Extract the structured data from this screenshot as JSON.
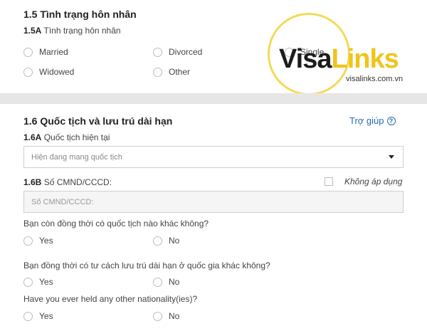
{
  "marital": {
    "title": "1.5 Tình trạng hôn nhân",
    "sub_code": "1.5A",
    "sub_label": "Tình trạng hôn nhân",
    "options": [
      "Married",
      "Divorced",
      "Single",
      "Widowed",
      "Other"
    ]
  },
  "nationality": {
    "title": "1.6 Quốc tịch và lưu trú dài hạn",
    "help_label": "Trợ giúp",
    "help_icon": "?",
    "q_6a_code": "1.6A",
    "q_6a_label": "Quốc tịch hiện tại",
    "select_value": "Hiện đang mang quốc tịch",
    "q_6b_code": "1.6B",
    "q_6b_label": "Số CMND/CCCD:",
    "not_applicable_label": "Không áp dụng",
    "id_placeholder": "Số CMND/CCCD:",
    "q_other_nationality": "Bạn còn đồng thời có quốc tịch nào khác không?",
    "q_other_residency": "Bạn đồng thời có tư cách lưu trú dài hạn ở quốc gia khác không?",
    "q_held_other": "Have you ever held any other nationality(ies)?",
    "yes": "Yes",
    "no": "No"
  },
  "watermark": {
    "brand_left": "Visa",
    "brand_right": "Links",
    "site": "visalinks.com.vn",
    "ring_color": "#f3d645",
    "accent_color": "#f0c41b"
  }
}
